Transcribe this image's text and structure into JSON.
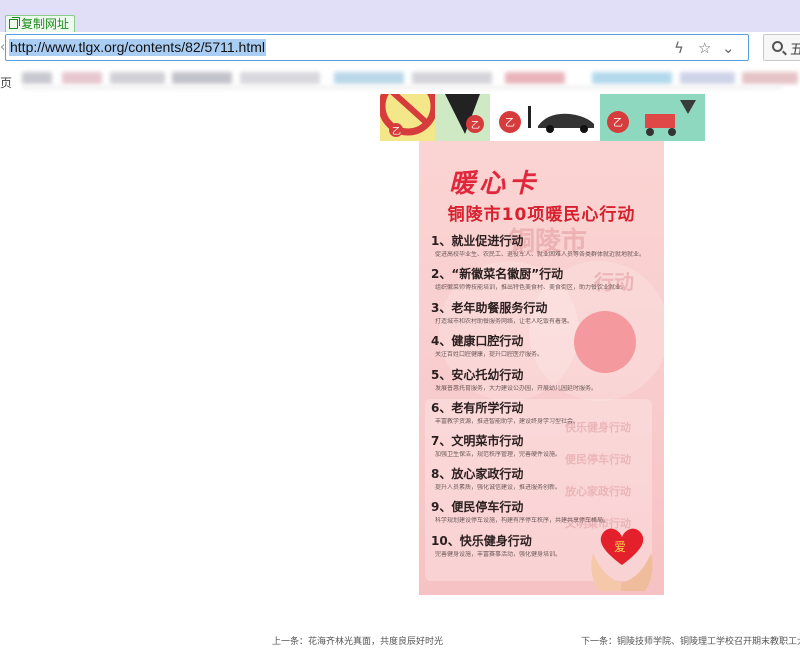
{
  "browser": {
    "copy_url_label": "复制网址",
    "url": "http://www.tlgx.org/contents/82/5711.html",
    "edge_char": "页",
    "search_char": "五"
  },
  "poster": {
    "card_title": "暖心卡",
    "subtitle": "铜陵市10项暖民心行动",
    "bg_text_1": "铜陵市",
    "bg_text_2": "行动",
    "bg_love": "爱",
    "items": [
      {
        "title": "1、就业促进行动",
        "desc": "促进高校毕业生、农民工、退役军人、就业困难人员等各类群体就近就地就业。"
      },
      {
        "title": "2、“新徽菜名徽厨”行动",
        "desc": "组织徽菜师傅技能培训，推出特色美食村、美食街区，助力餐饮业就业。"
      },
      {
        "title": "3、老年助餐服务行动",
        "desc": "打造城市和农村助餐服务网络，让老人吃饭有着落。"
      },
      {
        "title": "4、健康口腔行动",
        "desc": "关注百姓口腔健康，提升口腔医疗服务。"
      },
      {
        "title": "5、安心托幼行动",
        "desc": "发展普惠托育服务，大力建设公办园，开展幼儿园延时服务。"
      },
      {
        "title": "6、老有所学行动",
        "desc": "丰富教学资源，推进智能助学，建设终身学习型社会。"
      },
      {
        "title": "7、文明菜市行动",
        "desc": "加强卫生保洁，规范秩序管理，完善硬件设施。"
      },
      {
        "title": "8、放心家政行动",
        "desc": "提升人员素质，强化诚信建设，推进服务创新。"
      },
      {
        "title": "9、便民停车行动",
        "desc": "科学规划建设停车设施，构建有序停车秩序，共建共享停车格局。"
      },
      {
        "title": "10、快乐健身行动",
        "desc": "完善健身设施，丰富赛事活动，强化健身培训。"
      }
    ],
    "faint_panel": [
      "快乐健身行动",
      "便民停车行动",
      "放心家政行动",
      "文明菜市行动"
    ]
  },
  "footer": {
    "prev": "上一条：花海齐林光真面，共度良辰好时光",
    "next": "下一条：铜陵技师学院、铜陵理工学校召开期末教职工大会"
  },
  "colors": {
    "accent_red": "#e0283c",
    "url_highlight": "#aacdf3",
    "top_strip": "#e1def8"
  }
}
